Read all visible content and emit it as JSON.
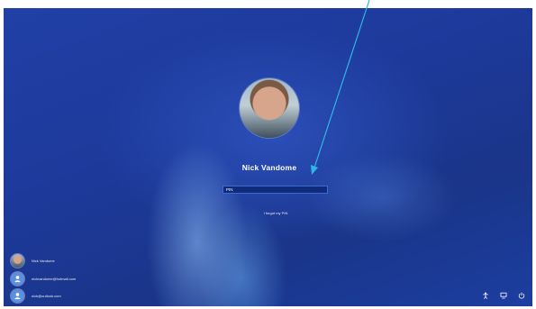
{
  "user": {
    "name": "Nick Vandome"
  },
  "login": {
    "pin_value": "PIN",
    "forgot_label": "I forgot my PIN"
  },
  "accounts": [
    {
      "label": "Nick Vandome"
    },
    {
      "label": "nickvandome@hotmail.com"
    },
    {
      "label": "nick@outlook.com"
    }
  ],
  "colors": {
    "accent": "#2fb6e6",
    "wallpaper": "#1d3a9b"
  },
  "icons": {
    "account_default": "person-icon",
    "system": [
      "accessibility-icon",
      "network-icon",
      "power-icon"
    ]
  }
}
